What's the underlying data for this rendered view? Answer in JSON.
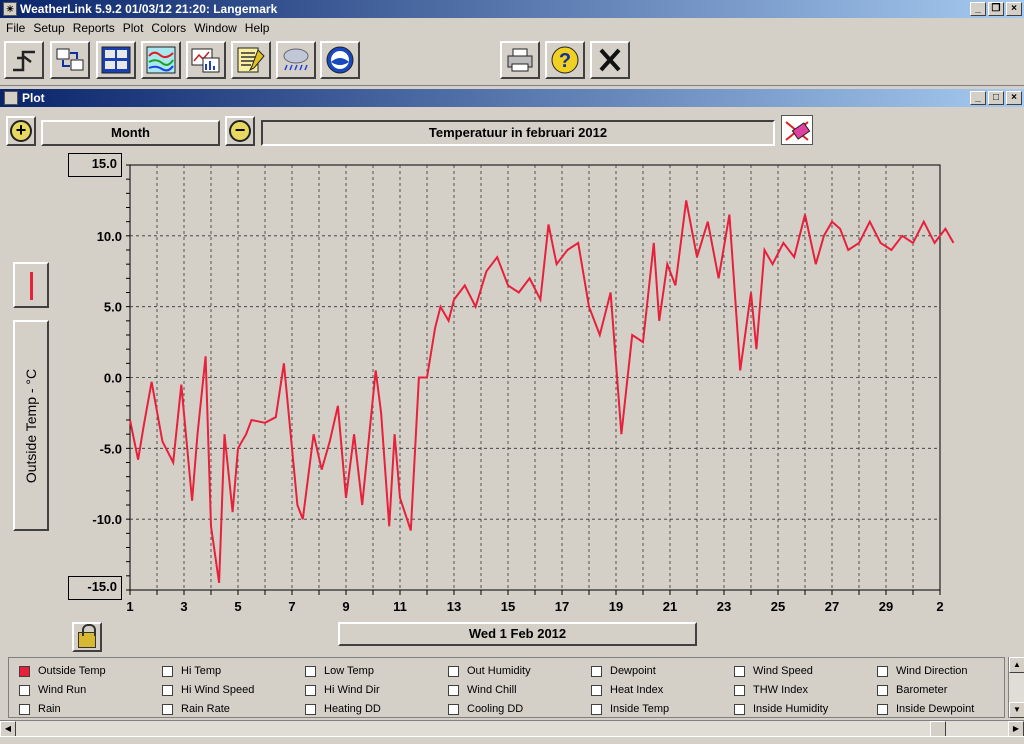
{
  "window": {
    "title": "WeatherLink 5.9.2  01/03/12  21:20: Langemark"
  },
  "menu": [
    "File",
    "Setup",
    "Reports",
    "Plot",
    "Colors",
    "Window",
    "Help"
  ],
  "toolbar": {
    "buttons": [
      "station-icon",
      "transfer-icon",
      "bulletin-icon",
      "summary-icon",
      "graph-icon",
      "noaa-report-icon",
      "weather-icon",
      "noaa-logo-icon"
    ],
    "print_icon": "printer-icon",
    "help_icon": "help-icon",
    "close_icon": "close-icon"
  },
  "plot_window": {
    "title": "Plot",
    "span_label": "Month",
    "plot_title": "Temperatuur in februari 2012",
    "y_axis_title": "Outside Temp - °C",
    "y_max_label": "15.0",
    "y_min_label": "-15.0",
    "x_axis_label": "Wed 1 Feb 2012"
  },
  "chart_data": {
    "type": "line",
    "ylabel": "Outside Temp - °C",
    "xlabel": "Wed 1 Feb 2012",
    "title": "Temperatuur in februari 2012",
    "ylim": [
      -15,
      15
    ],
    "y_ticks": [
      "15.0",
      "10.0",
      "5.0",
      "0.0",
      "-5.0",
      "-10.0",
      "-15.0"
    ],
    "x_ticks": [
      "1",
      "3",
      "5",
      "7",
      "9",
      "11",
      "13",
      "15",
      "17",
      "19",
      "21",
      "23",
      "25",
      "27",
      "29",
      "2"
    ],
    "grid": true,
    "series": [
      {
        "name": "Outside Temp",
        "color": "#e8203c",
        "x": [
          1.0,
          1.3,
          1.5,
          1.8,
          2.2,
          2.6,
          2.9,
          3.3,
          3.5,
          3.8,
          4.0,
          4.3,
          4.5,
          4.8,
          5.0,
          5.3,
          5.5,
          6.0,
          6.4,
          6.7,
          7.2,
          7.4,
          7.8,
          8.1,
          8.4,
          8.7,
          9.0,
          9.3,
          9.6,
          10.1,
          10.3,
          10.6,
          10.8,
          11.0,
          11.4,
          11.7,
          12.0,
          12.3,
          12.5,
          12.8,
          13.0,
          13.4,
          13.8,
          14.2,
          14.6,
          15.0,
          15.4,
          15.8,
          16.2,
          16.5,
          16.8,
          17.2,
          17.6,
          18.0,
          18.4,
          18.8,
          19.2,
          19.6,
          20.0,
          20.4,
          20.6,
          20.9,
          21.2,
          21.6,
          22.0,
          22.4,
          22.8,
          23.2,
          23.6,
          24.0,
          24.2,
          24.5,
          24.8,
          25.2,
          25.6,
          26.0,
          26.4,
          26.7,
          27.0,
          27.3,
          27.6,
          28.0,
          28.4,
          28.8,
          29.2,
          29.6,
          30.0,
          30.4,
          30.8,
          31.2,
          31.5
        ],
        "y": [
          -3.0,
          -5.8,
          -3.5,
          -0.3,
          -4.5,
          -6.0,
          -0.5,
          -8.7,
          -4.0,
          1.5,
          -10.5,
          -14.5,
          -4.0,
          -9.5,
          -5.0,
          -4.0,
          -3.0,
          -3.2,
          -2.8,
          1.0,
          -9.0,
          -10.0,
          -4.0,
          -6.5,
          -4.5,
          -2.0,
          -8.5,
          -4.0,
          -9.0,
          0.5,
          -2.5,
          -10.5,
          -4.0,
          -8.5,
          -10.8,
          0.0,
          0.0,
          3.5,
          5.0,
          4.0,
          5.5,
          6.5,
          5.0,
          7.5,
          8.5,
          6.5,
          6.0,
          7.0,
          5.5,
          10.8,
          8.0,
          9.0,
          9.5,
          5.0,
          3.0,
          6.0,
          -4.0,
          3.0,
          2.5,
          9.5,
          4.0,
          8.0,
          6.5,
          12.5,
          8.5,
          11.0,
          7.0,
          11.5,
          0.5,
          6.0,
          2.0,
          9.0,
          8.0,
          9.5,
          8.5,
          11.5,
          8.0,
          10.0,
          11.0,
          10.5,
          9.0,
          9.5,
          11.0,
          9.5,
          9.0,
          10.0,
          9.5,
          11.0,
          9.5,
          10.5,
          9.5
        ]
      }
    ]
  },
  "legend": {
    "items": [
      {
        "label": "Outside Temp",
        "checked": true
      },
      {
        "label": "Hi Temp",
        "checked": false
      },
      {
        "label": "Low Temp",
        "checked": false
      },
      {
        "label": "Out Humidity",
        "checked": false
      },
      {
        "label": "Dewpoint",
        "checked": false
      },
      {
        "label": "Wind Speed",
        "checked": false
      },
      {
        "label": "Wind Direction",
        "checked": false
      },
      {
        "label": "Wind Run",
        "checked": false
      },
      {
        "label": "Hi Wind Speed",
        "checked": false
      },
      {
        "label": "Hi Wind Dir",
        "checked": false
      },
      {
        "label": "Wind Chill",
        "checked": false
      },
      {
        "label": "Heat Index",
        "checked": false
      },
      {
        "label": "THW Index",
        "checked": false
      },
      {
        "label": "Barometer",
        "checked": false
      },
      {
        "label": "Rain",
        "checked": false
      },
      {
        "label": "Rain Rate",
        "checked": false
      },
      {
        "label": "Heating DD",
        "checked": false
      },
      {
        "label": "Cooling DD",
        "checked": false
      },
      {
        "label": "Inside Temp",
        "checked": false
      },
      {
        "label": "Inside Humidity",
        "checked": false
      },
      {
        "label": "Inside Dewpoint",
        "checked": false
      }
    ]
  }
}
